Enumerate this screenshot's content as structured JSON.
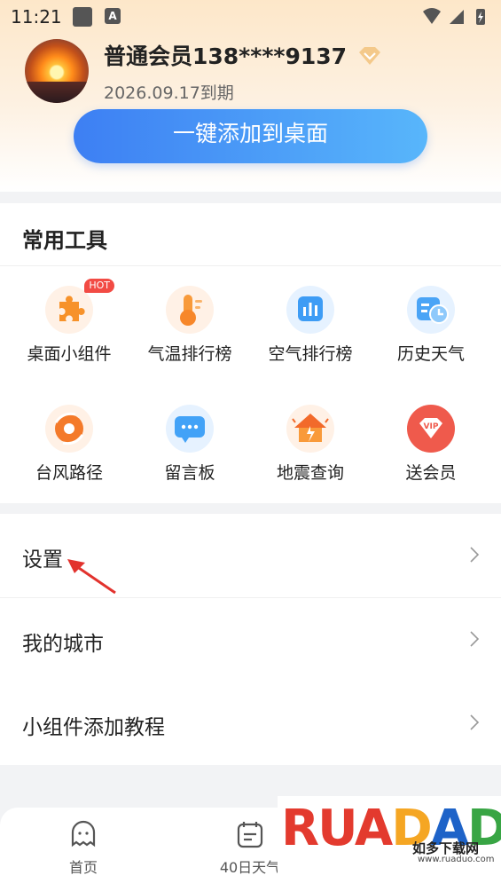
{
  "status_bar": {
    "time": "11:21"
  },
  "header": {
    "member_title": "普通会员138****9137",
    "expire_text": "2026.09.17到期",
    "add_button_label": "一键添加到桌面"
  },
  "tools": {
    "title": "常用工具",
    "items": [
      {
        "label": "桌面小组件",
        "icon": "puzzle-icon",
        "badge": "HOT"
      },
      {
        "label": "气温排行榜",
        "icon": "thermometer-icon"
      },
      {
        "label": "空气排行榜",
        "icon": "air-chart-icon"
      },
      {
        "label": "历史天气",
        "icon": "history-clock-icon"
      },
      {
        "label": "台风路径",
        "icon": "typhoon-icon"
      },
      {
        "label": "留言板",
        "icon": "message-board-icon"
      },
      {
        "label": "地震查询",
        "icon": "earthquake-icon"
      },
      {
        "label": "送会员",
        "icon": "vip-gift-icon"
      }
    ]
  },
  "menu": {
    "items": [
      {
        "label": "设置"
      },
      {
        "label": "我的城市"
      },
      {
        "label": "小组件添加教程"
      }
    ]
  },
  "bottom_nav": {
    "items": [
      {
        "label": "首页",
        "icon": "home-ghost-icon"
      },
      {
        "label": "40日天气",
        "icon": "calendar-icon"
      }
    ]
  },
  "watermark": {
    "brand": "RUADADUO",
    "cn": "如多下载网",
    "url": "www.ruaduo.com"
  },
  "colors": {
    "accent_blue": "#3d7ff3",
    "gold": "#f0b654",
    "hot_red": "#f24b44"
  }
}
